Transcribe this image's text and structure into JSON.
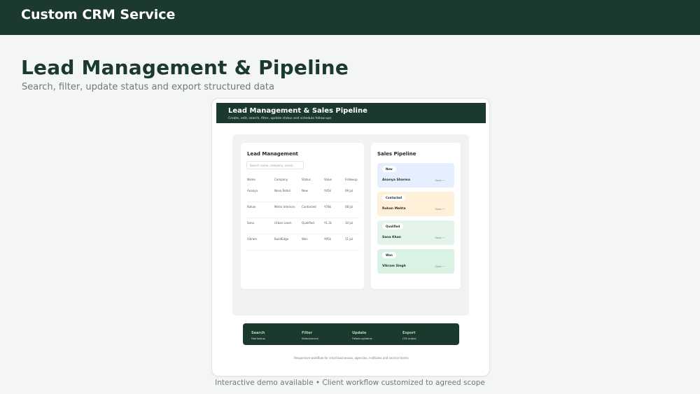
{
  "header": {
    "brand": "Custom CRM Service"
  },
  "hero": {
    "title": "Lead Management & Pipeline",
    "subtitle": "Search, filter, update status and export structured data"
  },
  "app": {
    "title": "Lead Management & Sales Pipeline",
    "subtitle": "Create, edit, search, filter, update status and schedule follow-ups"
  },
  "leads": {
    "title": "Lead Management",
    "search_placeholder": "Search name, company, email...",
    "columns": [
      "Name",
      "Company",
      "Status",
      "Value",
      "Followup"
    ],
    "rows": [
      [
        "Ananya",
        "Nova Retail",
        "New",
        "₹45k",
        "09 Jul"
      ],
      [
        "Rohan",
        "Metro Interiors",
        "Contacted",
        "₹78k",
        "08 Jul"
      ],
      [
        "Sana",
        "Urban Learn",
        "Qualified",
        "₹1.2L",
        "10 Jul"
      ],
      [
        "Vikram",
        "BuildEdge",
        "Won",
        "₹95k",
        "11 Jul"
      ]
    ]
  },
  "pipeline": {
    "title": "Sales Pipeline",
    "stages": [
      {
        "label": "New",
        "name": "Ananya Sharma",
        "action": "Open →",
        "color": "#e6efff"
      },
      {
        "label": "Contacted",
        "name": "Rohan Mehta",
        "action": "Open →",
        "color": "#fff0d9"
      },
      {
        "label": "Qualified",
        "name": "Sana Khan",
        "action": "Open →",
        "color": "#e4f4ea"
      },
      {
        "label": "Won",
        "name": "Vikram Singh",
        "action": "Open →",
        "color": "#d9f2e3"
      }
    ]
  },
  "actions": [
    {
      "title": "Search",
      "desc": "Fast lookup"
    },
    {
      "title": "Filter",
      "desc": "Status/source"
    },
    {
      "title": "Update",
      "desc": "Follow-up/status"
    },
    {
      "title": "Export",
      "desc": "CSV output"
    }
  ],
  "footer_note": "Responsive workflow for small businesses, agencies, institutes and service teams",
  "caption": "Interactive demo available • Client workflow customized to agreed scope",
  "colors": {
    "brand_dark": "#1b3a2d",
    "accent_green": "#a8dcbf",
    "page_bg": "#f4f6f5"
  }
}
